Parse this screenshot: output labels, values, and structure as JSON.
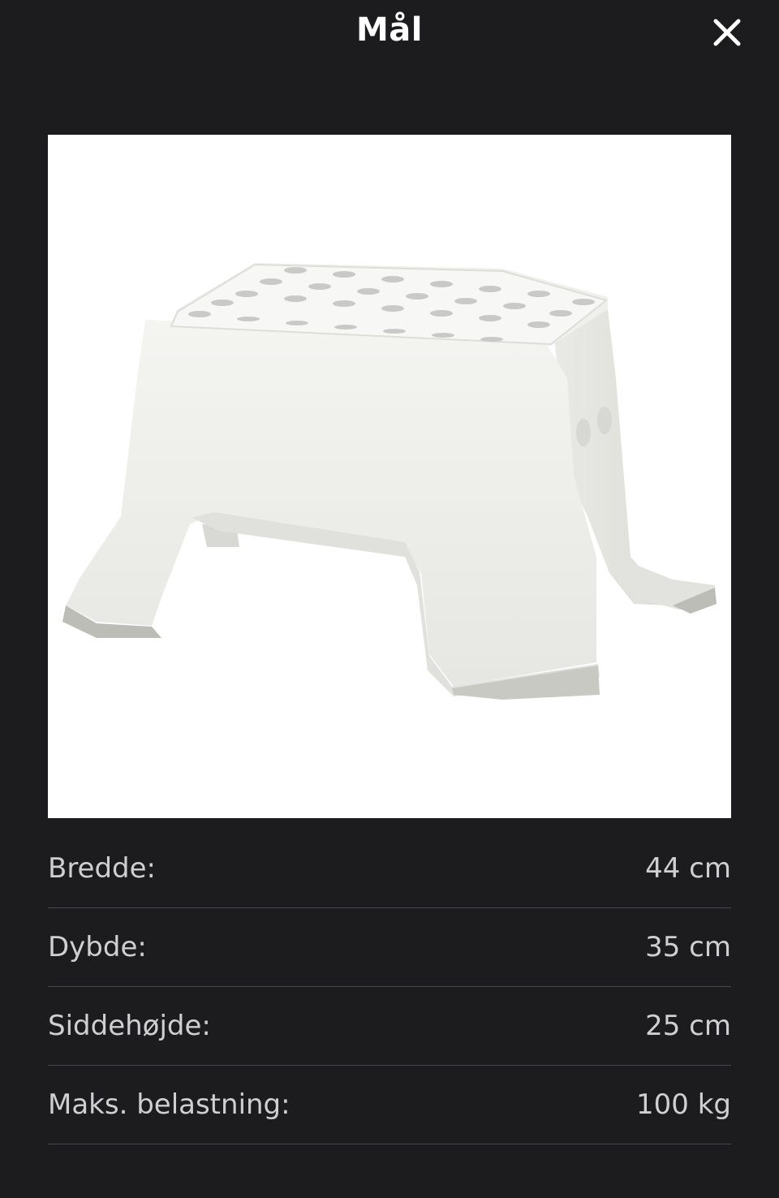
{
  "header": {
    "title": "Mål",
    "close_icon": "close-icon"
  },
  "product_image": {
    "subject": "white plastic step stool with perforated top"
  },
  "specs": [
    {
      "label": "Bredde:",
      "value": "44 cm"
    },
    {
      "label": "Dybde:",
      "value": "35 cm"
    },
    {
      "label": "Siddehøjde:",
      "value": "25 cm"
    },
    {
      "label": "Maks. belastning:",
      "value": "100 kg"
    }
  ],
  "colors": {
    "background": "#1c1c1e",
    "title": "#ffffff",
    "text": "#cfcfd2",
    "divider": "#48484c"
  }
}
